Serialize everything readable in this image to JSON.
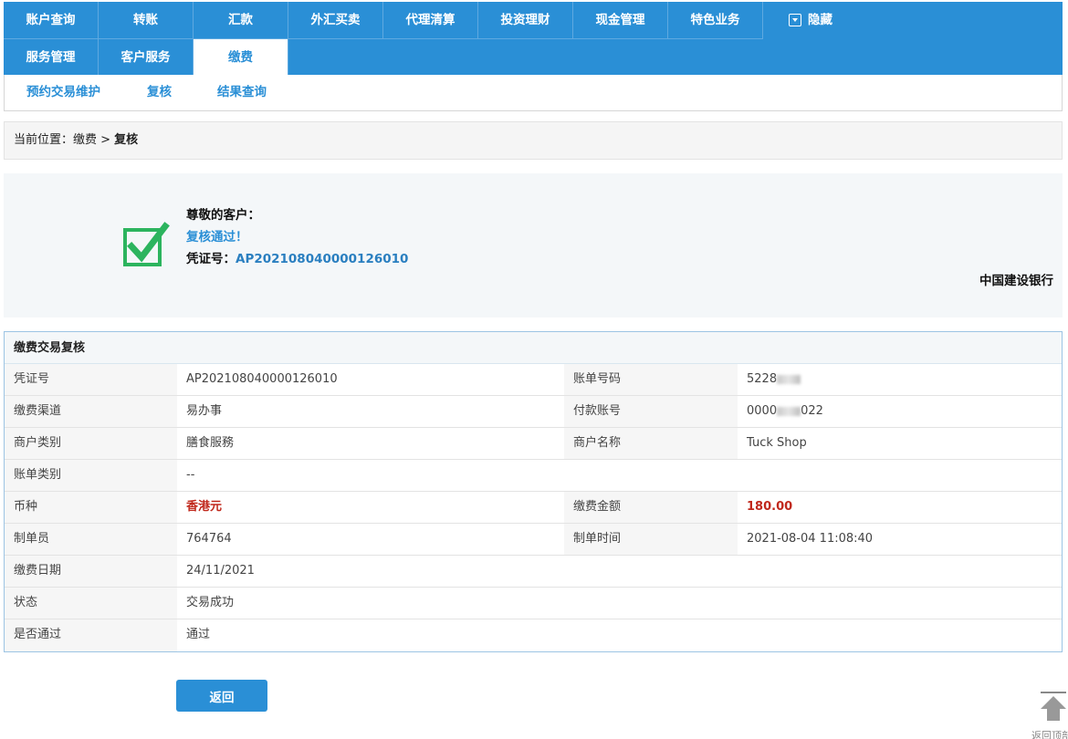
{
  "nav": {
    "row1": [
      "账户查询",
      "转账",
      "汇款",
      "外汇买卖",
      "代理清算",
      "投资理财",
      "现金管理",
      "特色业务"
    ],
    "hide_label": "隐藏",
    "row2": [
      "服务管理",
      "客户服务",
      "缴费"
    ],
    "active": "缴费"
  },
  "subnav": [
    "预约交易维护",
    "复核",
    "结果查询"
  ],
  "breadcrumb": {
    "prefix": "当前位置：缴费 > ",
    "current": "复核"
  },
  "result": {
    "greeting": "尊敬的客户：",
    "status": "复核通过！",
    "voucher_label": "凭证号：",
    "voucher_no": "AP202108040000126010",
    "bank": "中国建设银行"
  },
  "table": {
    "title": "缴费交易复核",
    "rows": [
      {
        "k1": "凭证号",
        "v1": "AP202108040000126010",
        "k2": "账单号码",
        "v2": "5228",
        "v2_masked": true
      },
      {
        "k1": "缴费渠道",
        "v1": "易办事",
        "k2": "付款账号",
        "v2a": "0000",
        "v2b": "022",
        "v2_masked": true
      },
      {
        "k1": "商户类别",
        "v1": "膳食服務",
        "k2": "商户名称",
        "v2": "Tuck Shop"
      },
      {
        "k1": "账单类别",
        "v1": "--"
      },
      {
        "k1": "币种",
        "v1": "香港元",
        "k2": "缴费金额",
        "v2": "180.00"
      },
      {
        "k1": "制单员",
        "v1": "764764",
        "k2": "制单时间",
        "v2": "2021-08-04 11:08:40"
      },
      {
        "k1": "缴费日期",
        "v1": "24/11/2021"
      },
      {
        "k1": "状态",
        "v1": "交易成功"
      },
      {
        "k1": "是否通过",
        "v1": "通过"
      }
    ]
  },
  "back_button": "返回",
  "to_top_label": "返回顶部",
  "colors": {
    "primary": "#2a8fd6",
    "success": "#2cb45e",
    "amount": "#c0281c"
  }
}
